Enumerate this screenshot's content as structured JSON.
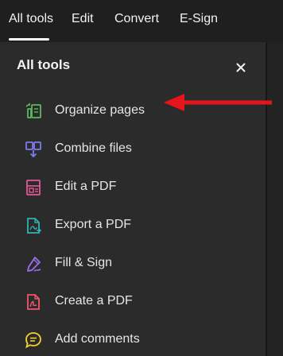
{
  "tabs": [
    {
      "label": "All tools",
      "active": true
    },
    {
      "label": "Edit",
      "active": false
    },
    {
      "label": "Convert",
      "active": false
    },
    {
      "label": "E-Sign",
      "active": false
    }
  ],
  "panel": {
    "title": "All tools",
    "close_icon": "close-icon"
  },
  "tools": [
    {
      "label": "Organize pages",
      "icon": "organize-pages-icon",
      "color": "#5cb85c"
    },
    {
      "label": "Combine files",
      "icon": "combine-files-icon",
      "color": "#7b7cf0"
    },
    {
      "label": "Edit a PDF",
      "icon": "edit-pdf-icon",
      "color": "#e5559a"
    },
    {
      "label": "Export a PDF",
      "icon": "export-pdf-icon",
      "color": "#2fb3ad"
    },
    {
      "label": "Fill & Sign",
      "icon": "fill-sign-icon",
      "color": "#9f6df0"
    },
    {
      "label": "Create a PDF",
      "icon": "create-pdf-icon",
      "color": "#f0566a"
    },
    {
      "label": "Add comments",
      "icon": "add-comments-icon",
      "color": "#f2d22b"
    }
  ],
  "annotation": {
    "arrow_color": "#e8141b",
    "arrow_icon": "red-arrow-icon"
  }
}
